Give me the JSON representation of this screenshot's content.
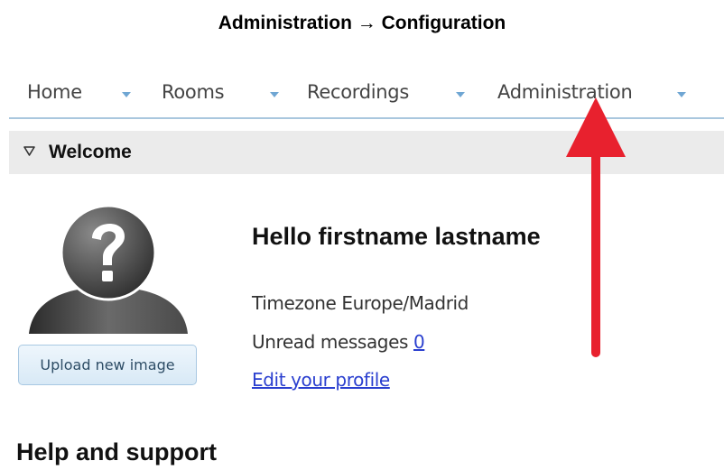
{
  "caption": "Administration → Configuration",
  "menu": {
    "items": [
      {
        "label": "Home"
      },
      {
        "label": "Rooms"
      },
      {
        "label": "Recordings"
      },
      {
        "label": "Administration"
      }
    ]
  },
  "welcome": {
    "title": "Welcome"
  },
  "profile": {
    "upload_label": "Upload new image",
    "greeting": "Hello firstname lastname",
    "timezone_text": "Timezone Europe/Madrid",
    "unread_label": "Unread messages",
    "unread_count": "0",
    "edit_profile_label": "Edit your profile"
  },
  "help": {
    "title": "Help and support"
  },
  "colors": {
    "arrow": "#e8212e",
    "link": "#2a3fcf",
    "menu_caret": "#6fa6d3"
  }
}
